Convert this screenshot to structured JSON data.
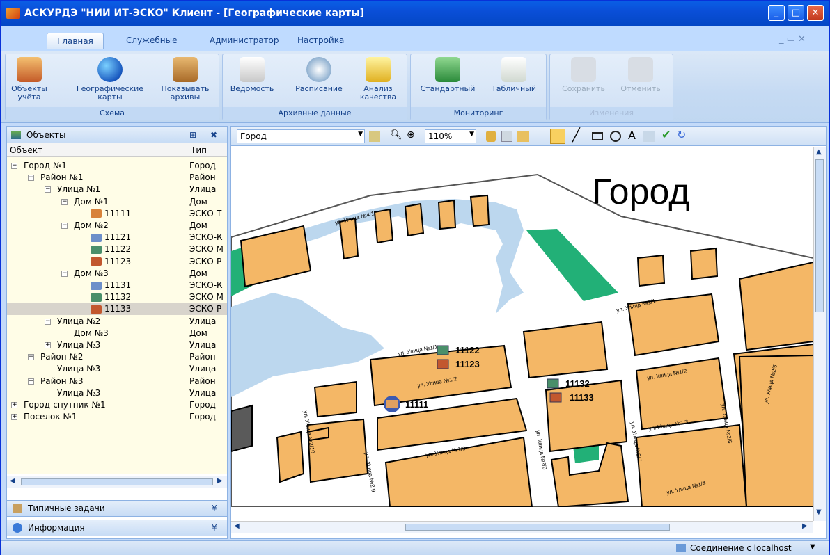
{
  "window": {
    "title": "АСКУРДЭ \"НИИ ИТ-ЭСКО\" Клиент - [Географические карты]"
  },
  "ribbon": {
    "tabs": [
      "Главная",
      "Служебные",
      "Администратор",
      "Настройка"
    ],
    "groups": [
      {
        "label": "Схема",
        "buttons": [
          {
            "label1": "Объекты",
            "label2": "учёта"
          },
          {
            "label1": "Географические",
            "label2": "карты"
          },
          {
            "label1": "Показывать",
            "label2": "архивы"
          }
        ]
      },
      {
        "label": "Архивные данные",
        "buttons": [
          {
            "label1": "Ведомость",
            "label2": ""
          },
          {
            "label1": "Расписание",
            "label2": ""
          },
          {
            "label1": "Анализ",
            "label2": "качества"
          }
        ]
      },
      {
        "label": "Мониторинг",
        "buttons": [
          {
            "label1": "Стандартный",
            "label2": ""
          },
          {
            "label1": "Табличный",
            "label2": ""
          }
        ]
      },
      {
        "label": "Изменения",
        "buttons": [
          {
            "label1": "Сохранить",
            "label2": ""
          },
          {
            "label1": "Отменить",
            "label2": ""
          }
        ]
      }
    ]
  },
  "left": {
    "title": "Объекты",
    "col_object": "Объект",
    "col_type": "Тип",
    "rows": [
      {
        "name": "Город №1",
        "type": "Город",
        "level": 0,
        "pm": "-"
      },
      {
        "name": "Район №1",
        "type": "Район",
        "level": 1,
        "pm": "-"
      },
      {
        "name": "Улица №1",
        "type": "Улица",
        "level": 2,
        "pm": "-"
      },
      {
        "name": "Дом №1",
        "type": "Дом",
        "level": 3,
        "pm": "-"
      },
      {
        "name": "11111",
        "type": "ЭСКО-Т",
        "level": 4,
        "pm": "",
        "dev": "#d8823a"
      },
      {
        "name": "Дом №2",
        "type": "Дом",
        "level": 3,
        "pm": "-"
      },
      {
        "name": "11121",
        "type": "ЭСКО-К",
        "level": 4,
        "pm": "",
        "dev": "#6d8fc9"
      },
      {
        "name": "11122",
        "type": "ЭСКО М",
        "level": 4,
        "pm": "",
        "dev": "#4a8f6a"
      },
      {
        "name": "11123",
        "type": "ЭСКО-Р",
        "level": 4,
        "pm": "",
        "dev": "#c2572e"
      },
      {
        "name": "Дом №3",
        "type": "Дом",
        "level": 3,
        "pm": "-"
      },
      {
        "name": "11131",
        "type": "ЭСКО-К",
        "level": 4,
        "pm": "",
        "dev": "#6d8fc9"
      },
      {
        "name": "11132",
        "type": "ЭСКО М",
        "level": 4,
        "pm": "",
        "dev": "#4a8f6a"
      },
      {
        "name": "11133",
        "type": "ЭСКО-Р",
        "level": 4,
        "pm": "",
        "dev": "#c2572e",
        "sel": true
      },
      {
        "name": "Улица №2",
        "type": "Улица",
        "level": 2,
        "pm": "-"
      },
      {
        "name": "Дом №3",
        "type": "Дом",
        "level": 3,
        "pm": ""
      },
      {
        "name": "Улица №3",
        "type": "Улица",
        "level": 2,
        "pm": "+"
      },
      {
        "name": "Район №2",
        "type": "Район",
        "level": 1,
        "pm": "-"
      },
      {
        "name": "Улица №3",
        "type": "Улица",
        "level": 2,
        "pm": ""
      },
      {
        "name": "Район №3",
        "type": "Район",
        "level": 1,
        "pm": "-"
      },
      {
        "name": "Улица №3",
        "type": "Улица",
        "level": 2,
        "pm": ""
      },
      {
        "name": "Город-спутник №1",
        "type": "Город",
        "level": 0,
        "pm": "+"
      },
      {
        "name": "Поселок №1",
        "type": "Город",
        "level": 0,
        "pm": "+"
      }
    ],
    "panel_tasks": "Типичные задачи",
    "panel_info": "Информация"
  },
  "map": {
    "layer": "Город",
    "zoom": "110%",
    "title": "Город",
    "streets": [
      "ул. Улица №4/1",
      "ул. Улица №1/1",
      "ул. Улица №1/1",
      "ул. Улица №1/2",
      "ул. Улица №1/2",
      "ул. Улица №1/3",
      "ул. Улица №1/3",
      "ул. Улица №1/4",
      "ул. Улица №2/10",
      "ул. Улица №2/9",
      "ул. Улица №2/8",
      "ул. Улица №2/7",
      "ул. Улица №2/6",
      "ул. Улица №2/5"
    ],
    "devices": [
      "11122",
      "11123",
      "11111",
      "11132",
      "11133"
    ]
  },
  "status": {
    "connection": "Соединение с localhost"
  }
}
